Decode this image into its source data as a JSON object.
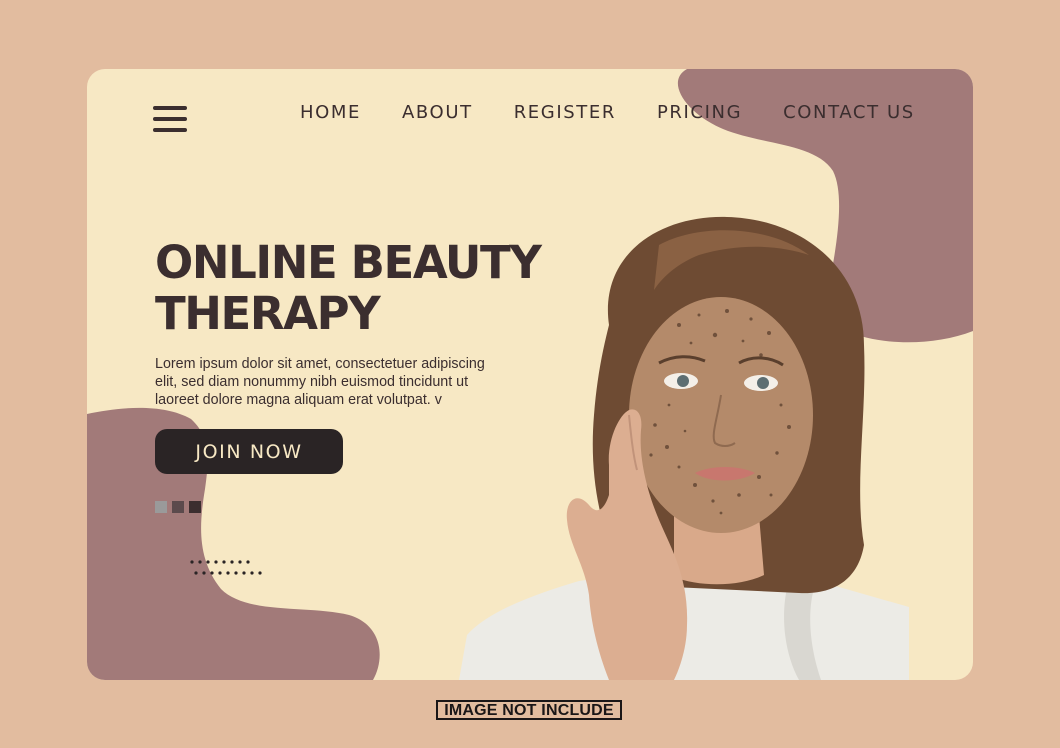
{
  "nav": {
    "items": [
      "HOME",
      "ABOUT",
      "REGISTER",
      "PRICING",
      "CONTACT US"
    ]
  },
  "hero": {
    "title_line1": "ONLINE BEAUTY",
    "title_line2": "THERAPY",
    "body": "Lorem ipsum dolor sit amet, consectetuer adipiscing elit, sed diam nonummy nibh euismod tincidunt ut laoreet dolore magna aliquam erat volutpat. v",
    "cta_label": "JOIN NOW"
  },
  "slider_dots": {
    "count": 3,
    "colors": [
      "#9a9a9a",
      "#5b4a4c",
      "#3b2e2f"
    ]
  },
  "photo": {
    "subject": "woman applying face scrub mask"
  },
  "footer": {
    "label": "IMAGE NOT INCLUDE"
  },
  "colors": {
    "page_background": "#e2bc9f",
    "card_background": "#f7e8c4",
    "blob": "#a27a79",
    "text_dark": "#3b2e2f",
    "button": "#2a2425",
    "button_text": "#f7e8c4"
  },
  "icons": {
    "menu": "hamburger-menu-icon"
  }
}
